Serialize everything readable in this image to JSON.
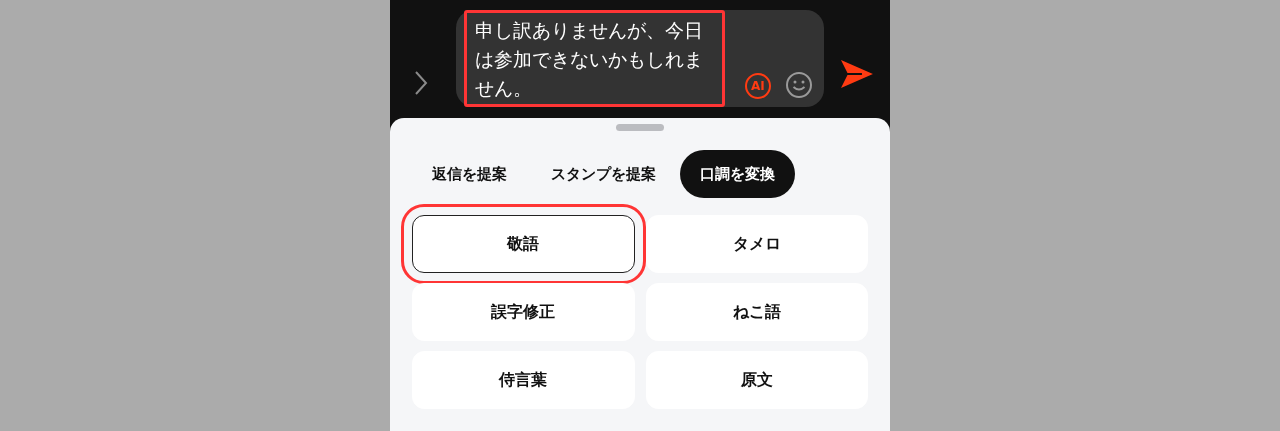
{
  "composer": {
    "message": "申し訳ありませんが、今日は参加できないかもしれません。",
    "highlighted": true,
    "ai_button": "AI"
  },
  "tabs": [
    {
      "label": "返信を提案",
      "selected": false
    },
    {
      "label": "スタンプを提案",
      "selected": false
    },
    {
      "label": "口調を変換",
      "selected": true
    }
  ],
  "options": [
    {
      "label": "敬語",
      "selected": true,
      "highlighted": true
    },
    {
      "label": "タメロ",
      "selected": false,
      "highlighted": false
    },
    {
      "label": "誤字修正",
      "selected": false,
      "highlighted": false
    },
    {
      "label": "ねこ語",
      "selected": false,
      "highlighted": false
    },
    {
      "label": "侍言葉",
      "selected": false,
      "highlighted": false
    },
    {
      "label": "原文",
      "selected": false,
      "highlighted": false
    }
  ]
}
